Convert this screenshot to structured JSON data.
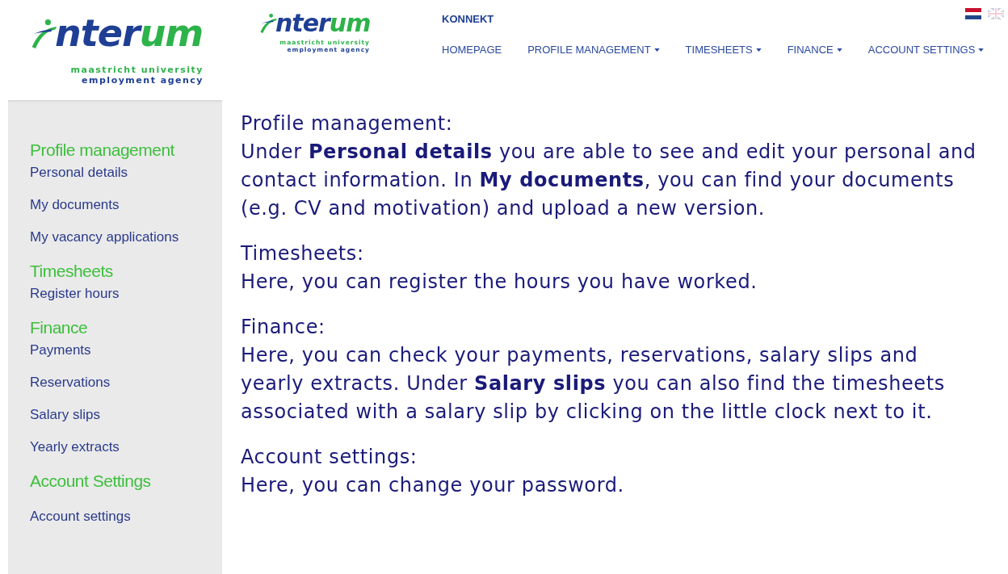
{
  "logo_large": {
    "wordmark_a": "nter",
    "wordmark_b": "um",
    "tagline_1": "maastricht university",
    "tagline_2": "employment agency"
  },
  "logo_small": {
    "wordmark_a": "nter",
    "wordmark_b": "um",
    "tagline_1": "maastricht university",
    "tagline_2": "employment agency"
  },
  "brand": "KONNEKT",
  "languages": [
    {
      "kind": "nl",
      "selected": true
    },
    {
      "kind": "en",
      "selected": false
    }
  ],
  "nav": [
    {
      "label": "HOMEPAGE",
      "has_menu": false
    },
    {
      "label": "PROFILE MANAGEMENT",
      "has_menu": true
    },
    {
      "label": "TIMESHEETS",
      "has_menu": true
    },
    {
      "label": "FINANCE",
      "has_menu": true
    },
    {
      "label": "ACCOUNT SETTINGS",
      "has_menu": true
    }
  ],
  "sidebar": [
    {
      "heading": "Profile management",
      "items": [
        "Personal details",
        "My documents",
        "My vacancy applications"
      ]
    },
    {
      "heading": "Timesheets",
      "items": [
        "Register hours"
      ]
    },
    {
      "heading": "Finance",
      "items": [
        "Payments",
        "Reservations",
        "Salary slips",
        "Yearly extracts"
      ]
    },
    {
      "heading": "Account Settings",
      "items": [
        "Account settings"
      ]
    }
  ],
  "sections": [
    {
      "title": "Profile management:",
      "text": "Under **Personal details** you are able to see and edit your personal and contact information. In **My documents**, you can find your documents (e.g. CV and motivation) and upload a new version."
    },
    {
      "title": "Timesheets:",
      "text": "Here, you can register the hours you have worked."
    },
    {
      "title": "Finance:",
      "text": "Here, you can check your payments, reservations, salary slips and yearly extracts. Under **Salary slips** you can also find the timesheets associated with a salary slip by clicking on the little clock next to it."
    },
    {
      "title": "Account settings:",
      "text": "Here, you can change your password."
    }
  ]
}
